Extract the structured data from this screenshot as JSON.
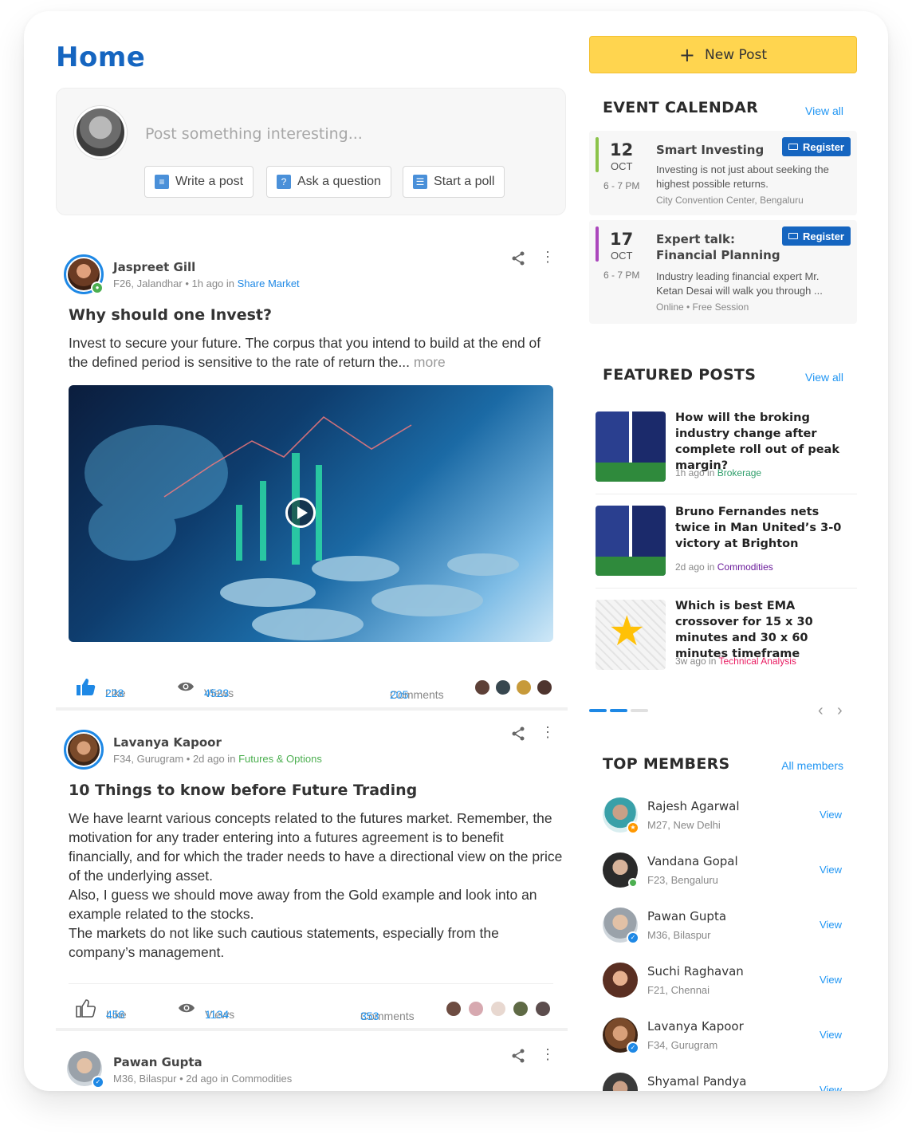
{
  "page": {
    "title": "Home"
  },
  "composer": {
    "placeholder": "Post something interesting...",
    "actions": [
      {
        "label": "Write a post",
        "icon": "comment-icon"
      },
      {
        "label": "Ask a question",
        "icon": "question-icon"
      },
      {
        "label": "Start a poll",
        "icon": "poll-icon"
      }
    ]
  },
  "posts": [
    {
      "author": "Jaspreet Gill",
      "meta": "F26, Jalandhar",
      "time": "1h ago in",
      "category": "Share Market",
      "category_color": "#1e88e5",
      "title": "Why should one Invest?",
      "body": "Invest to secure your future. The corpus that you intend to build at the end of the defined period is sensitive to the rate of return the...",
      "more": "more",
      "like_label": "Like",
      "likes": "228",
      "views_label": "Views",
      "views": "4523",
      "comments_label": "Comments",
      "comments": "205"
    },
    {
      "author": "Lavanya Kapoor",
      "meta": "F34, Gurugram",
      "time": "2d ago in",
      "category": "Futures & Options",
      "category_color": "#4caf50",
      "title": "10 Things to know before Future Trading",
      "body_lines": [
        "We have learnt various concepts related to the futures market. Remember, the motivation for any trader entering into a futures agreement is to benefit financially, and for which the trader needs to have a directional view on the price of the underlying asset.",
        "Also, I guess we should move away from the Gold example and look into an example related to the stocks.",
        "The markets do not like such cautious statements, especially from the company’s management."
      ],
      "like_label": "Like",
      "likes": "456",
      "views_label": "Views",
      "views": "1134",
      "comments_label": "Comments",
      "comments": "353"
    },
    {
      "author": "Pawan Gupta",
      "meta": "M36, Bilaspur",
      "time": "2d ago in",
      "category": "Commodities",
      "category_color": "#888888"
    }
  ],
  "sidebar": {
    "new_post_label": "New Post",
    "events": {
      "title": "EVENT CALENDAR",
      "view_all": "View all",
      "items": [
        {
          "day": "12",
          "month": "OCT",
          "time": "6 - 7 PM",
          "title": "Smart Investing",
          "desc": "Investing is not just about seeking the highest possible returns.",
          "location": "City Convention Center, Bengaluru",
          "register": "Register",
          "color": "#8bc34a"
        },
        {
          "day": "17",
          "month": "OCT",
          "time": "6 - 7 PM",
          "title": "Expert talk: Financial Planning",
          "desc": "Industry leading financial expert Mr. Ketan Desai will walk you through ...",
          "location": "Online • Free Session",
          "register": "Register",
          "color": "#ab47bc"
        }
      ]
    },
    "featured": {
      "title": "FEATURED POSTS",
      "view_all": "View all",
      "items": [
        {
          "title": "How will the broking industry change after complete roll out of peak margin?",
          "time": "1h ago in",
          "category": "Brokerage",
          "color": "#2e9e6a"
        },
        {
          "title": "Bruno Fernandes nets twice in Man United’s 3-0 victory at Brighton",
          "time": "2d ago in",
          "category": "Commodities",
          "color": "#6a1b9a"
        },
        {
          "title": "Which is best EMA crossover for 15 x 30 minutes and 30 x 60 minutes timeframe",
          "time": "3w ago in",
          "category": "Technical Analysis",
          "color": "#e91e63"
        }
      ]
    },
    "members": {
      "title": "TOP MEMBERS",
      "all_label": "All members",
      "items": [
        {
          "name": "Rajesh Agarwal",
          "meta": "M27, New Delhi",
          "view": "View",
          "badge": "#ff9800"
        },
        {
          "name": "Vandana Gopal",
          "meta": "F23, Bengaluru",
          "view": "View",
          "badge": "#4caf50"
        },
        {
          "name": "Pawan Gupta",
          "meta": "M36, Bilaspur",
          "view": "View",
          "badge": "#1e88e5"
        },
        {
          "name": "Suchi Raghavan",
          "meta": "F21, Chennai",
          "view": "View",
          "badge": ""
        },
        {
          "name": "Lavanya Kapoor",
          "meta": "F34, Gurugram",
          "view": "View",
          "badge": "#1e88e5"
        },
        {
          "name": "Shyamal Pandya",
          "meta": "",
          "view": "View",
          "badge": ""
        }
      ]
    }
  }
}
